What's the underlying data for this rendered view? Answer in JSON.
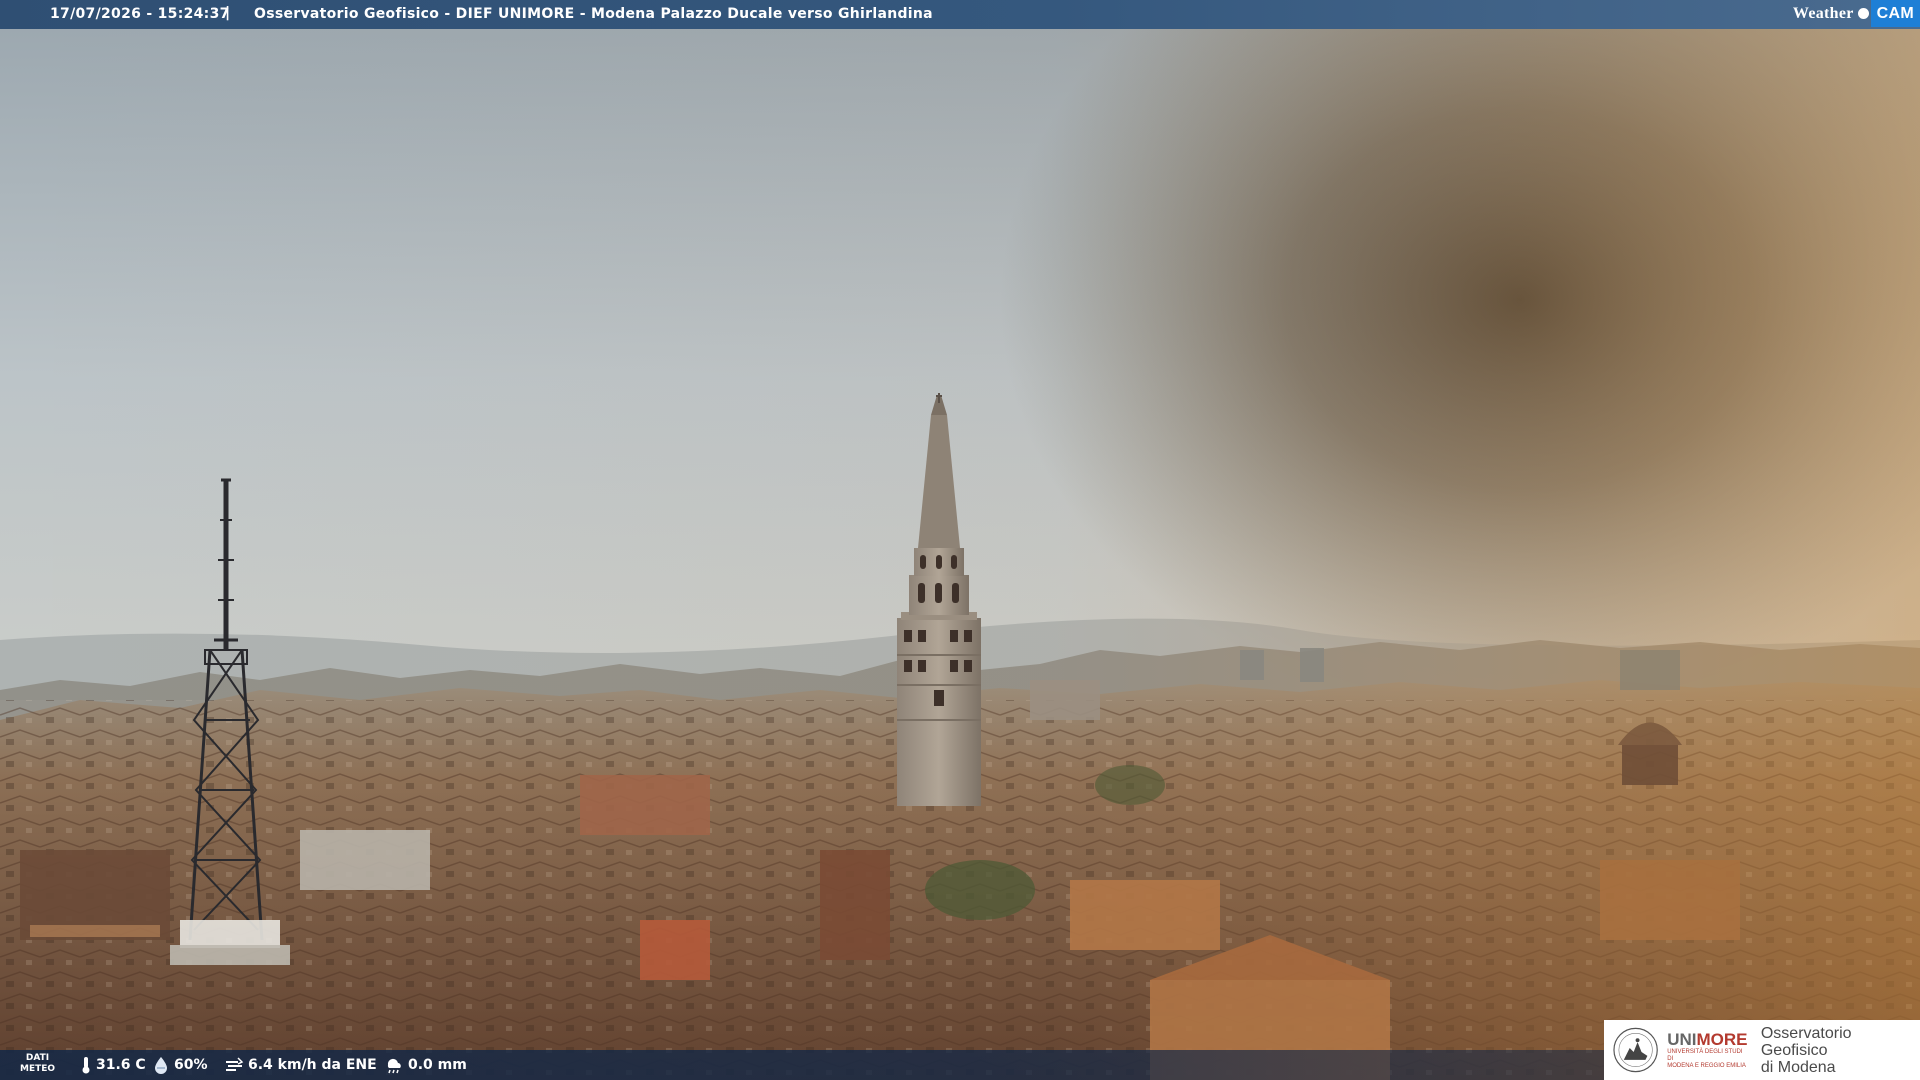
{
  "header": {
    "timestamp": "17/07/2026 - 15:24:37",
    "separator": "|",
    "station_title": "Osservatorio Geofisico - DIEF UNIMORE - Modena Palazzo Ducale verso Ghirlandina"
  },
  "brand": {
    "weather_word": "Weather",
    "cam_word": "CAM",
    "cam_color": "#1e7fd6"
  },
  "weather_bar": {
    "label_line1": "DATI",
    "label_line2": "METEO",
    "temperature": "31.6 C",
    "humidity": "60%",
    "wind": "6.4 km/h da ENE",
    "rain": "0.0 mm",
    "icons": [
      "thermometer-icon",
      "humidity-drop-icon",
      "wind-icon",
      "rain-icon"
    ]
  },
  "unimore_logo": {
    "uni": "UNI",
    "more": "MORE",
    "sub_line1": "UNIVERSITÀ DEGLI STUDI DI",
    "sub_line2": "MODENA E REGGIO EMILIA",
    "observatory_line1": "Osservatorio Geofisico",
    "observatory_line2": "di Modena",
    "accent_color": "#b33a2f"
  }
}
